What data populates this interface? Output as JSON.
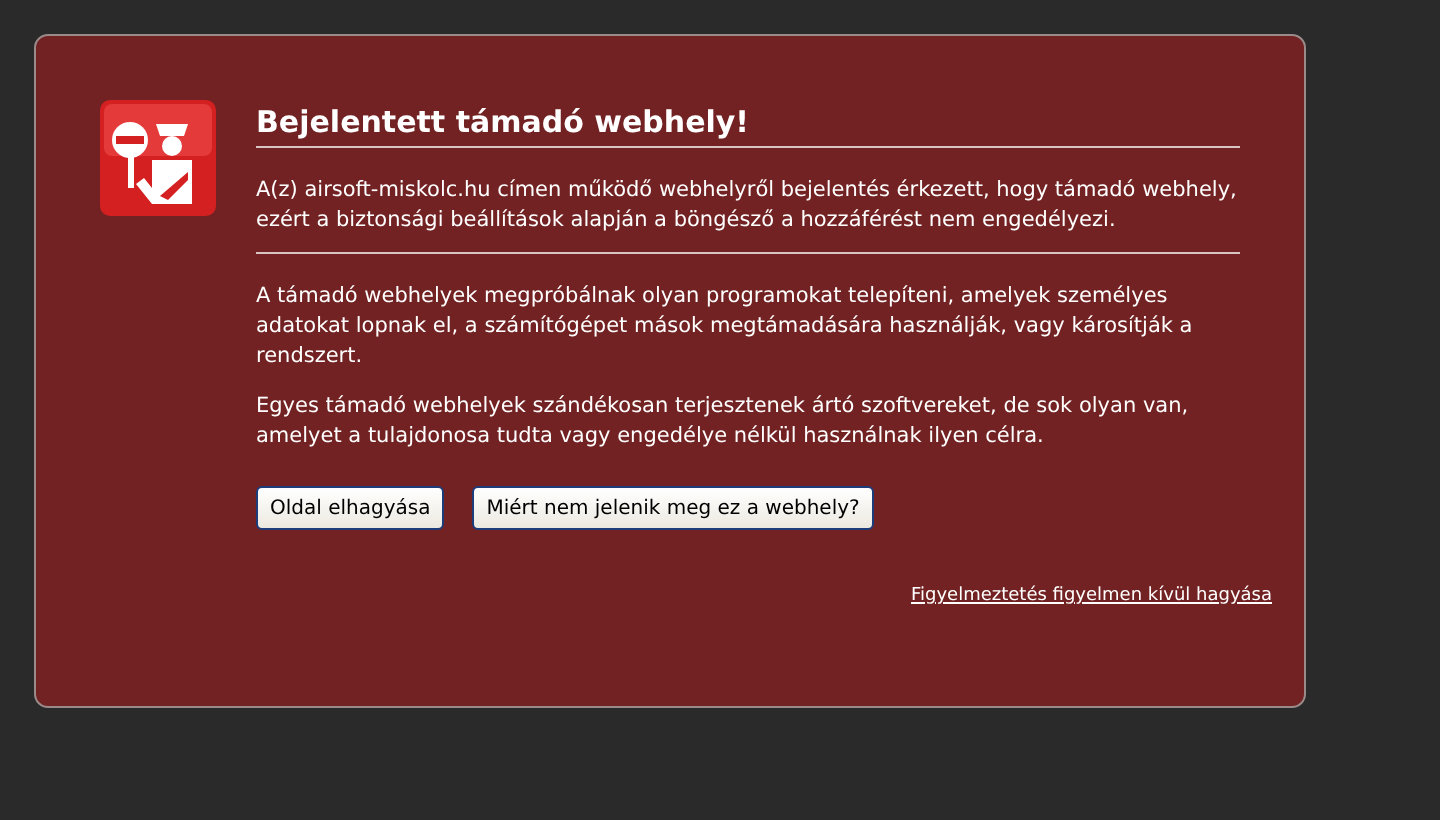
{
  "title": "Bejelentett támadó webhely!",
  "intro": "A(z) airsoft-miskolc.hu címen működő webhelyről bejelentés érkezett, hogy támadó webhely, ezért a biztonsági beállítások alapján a böngésző a hozzáférést nem engedélyezi.",
  "paragraphs": [
    "A támadó webhelyek megpróbálnak olyan programokat telepíteni, amelyek személyes adatokat lopnak el, a számítógépet mások megtámadására használják, vagy károsítják a rendszert.",
    "Egyes támadó webhelyek szándékosan terjesztenek ártó szoftvereket, de sok olyan van, amelyet a tulajdonosa tudta vagy engedélye nélkül használnak ilyen célra."
  ],
  "buttons": [
    "Oldal elhagyása",
    "Miért nem jelenik meg ez a webhely?"
  ],
  "ignore_link": "Figyelmeztetés figyelmen kívül hagyása"
}
